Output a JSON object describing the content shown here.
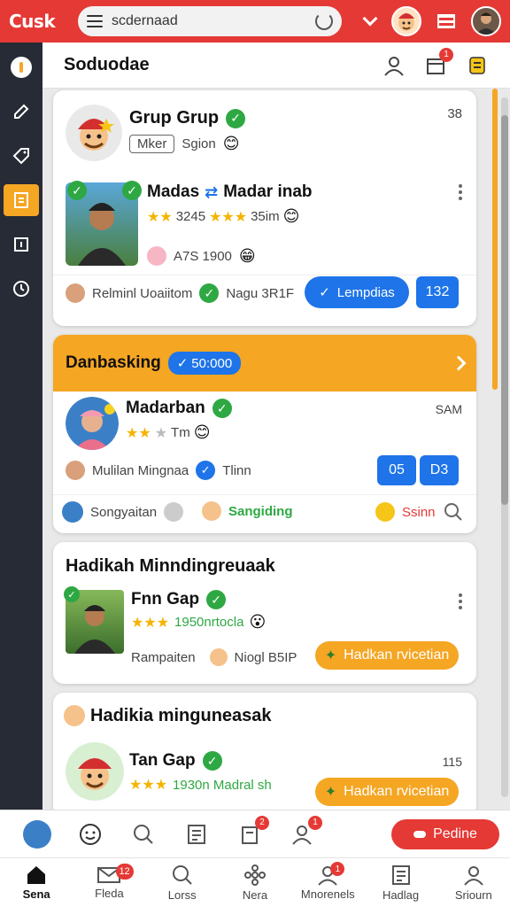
{
  "app": {
    "logo": "Cusk",
    "colors": {
      "accent": "#e53935",
      "highlight": "#f5a623",
      "link": "#1e74e8",
      "ok": "#2ea843"
    }
  },
  "search": {
    "value": "scdernaad"
  },
  "header": {
    "title": "Soduodae",
    "notif_count": "1"
  },
  "card1": {
    "group_name": "Grup Grup",
    "group_count": "38",
    "tag_label": "Mker",
    "tag_sub": "Sgion",
    "person_name": "Madas",
    "person_alt": "Madar inab",
    "rating_text": "3245",
    "rating_text2": "35im",
    "sub_value": "A7S 1900",
    "footer_left": "Relminl Uoaiitom",
    "footer_mid": "Nagu 3R1F",
    "button_label": "Lempdias",
    "count_button": "132"
  },
  "card2": {
    "header_title": "Danbasking",
    "header_pill": "50:000",
    "person_name": "Madarban",
    "time": "SAM",
    "rating_suffix": "Tm",
    "sub_left": "Mulilan Mingnaa",
    "sub_mid": "Tlinn",
    "btn_a": "05",
    "btn_b": "D3",
    "foot_a": "Songyaitan",
    "foot_b": "Sangiding",
    "foot_c": "Ssinn"
  },
  "card3": {
    "title": "Hadikah Minndingreuaak",
    "person_name": "Fnn Gap",
    "rating_text": "1950nrtocla",
    "sub_left": "Rampaiten",
    "sub_mid": "Niogl B5IP",
    "button_label": "Hadkan rvicetian"
  },
  "card4": {
    "title": "Hadikia minguneasak",
    "person_name": "Tan Gap",
    "count": "115",
    "rating_text": "1930n Madral sh",
    "button_label": "Hadkan rvicetian"
  },
  "actionbar": {
    "badge_a": "2",
    "badge_b": "1",
    "red_button": "Pedine"
  },
  "nav": {
    "items": [
      {
        "label": "Sena",
        "badge": ""
      },
      {
        "label": "Fleda",
        "badge": "12"
      },
      {
        "label": "Lorss",
        "badge": ""
      },
      {
        "label": "Nera",
        "badge": ""
      },
      {
        "label": "Mnorenels",
        "badge": "1"
      },
      {
        "label": "Hadlag",
        "badge": ""
      },
      {
        "label": "Sriourn",
        "badge": ""
      }
    ]
  }
}
